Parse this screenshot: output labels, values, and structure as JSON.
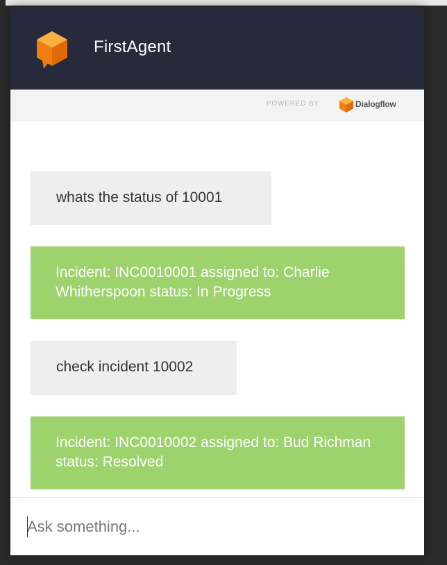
{
  "header": {
    "agent_name": "FirstAgent",
    "logo_icon": "cube-icon",
    "brand_color": "#f18b1b",
    "background": "#262a3b"
  },
  "powered_by": {
    "label": "POWERED BY",
    "brand": "Dialogflow",
    "icon": "dialogflow-icon"
  },
  "messages": [
    {
      "sender": "user",
      "text": "whats the status of 10001"
    },
    {
      "sender": "bot",
      "text": "Incident: INC0010001 assigned to: Charlie Whitherspoon status: In Progress"
    },
    {
      "sender": "user",
      "text": "check incident 10002"
    },
    {
      "sender": "bot",
      "text": "Incident: INC0010002 assigned to: Bud Richman status: Resolved"
    }
  ],
  "input": {
    "placeholder": "Ask something...",
    "value": ""
  },
  "colors": {
    "user_bubble": "#eeeeee",
    "bot_bubble": "#9dd26c"
  }
}
